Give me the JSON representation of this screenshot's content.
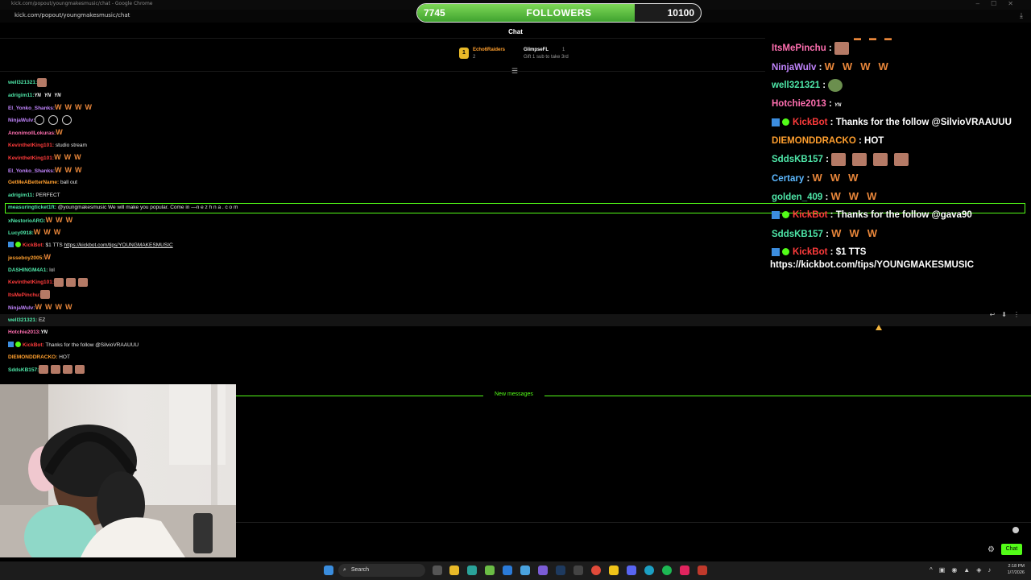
{
  "browser": {
    "title": "kick.com/popout/youngmakesmusic/chat - Google Chrome",
    "url": "kick.com/popout/youngmakesmusic/chat"
  },
  "followers_goal": {
    "current": "7745",
    "label": "FOLLOWERS",
    "goal": "10100",
    "progress": 0.767
  },
  "chat_title": "Chat",
  "pinned": {
    "user1": "Echo6Raiders",
    "user1_count": "2",
    "user1_rank": "1",
    "user2": "GlimpseFL",
    "user2_count": "1",
    "gift_text": "Gift 1 sub to take 3rd"
  },
  "small_chat": [
    {
      "user": "well321321:",
      "color": "#4ee6a8",
      "msg": ""
    },
    {
      "user": "adrigim11:",
      "color": "#4ee6a8",
      "msg": ""
    },
    {
      "user": "El_Yonko_Shanks:",
      "color": "#c084fc",
      "msg": ""
    },
    {
      "user": "NinjaWulv:",
      "color": "#c084fc",
      "msg": ""
    },
    {
      "user": "AnonimollLokuras:",
      "color": "#ff6fb0",
      "msg": ""
    },
    {
      "user": "KevinthetKing101:",
      "color": "#ff3b3b",
      "msg": "studio stream"
    },
    {
      "user": "KevinthetKing101:",
      "color": "#ff3b3b",
      "msg": ""
    },
    {
      "user": "El_Yonko_Shanks:",
      "color": "#c084fc",
      "msg": ""
    },
    {
      "user": "GetMeABetterName:",
      "color": "#ff9f2e",
      "msg": "ball out"
    },
    {
      "user": "adrigim11:",
      "color": "#4ee6a8",
      "msg": "PERFECT"
    },
    {
      "user": "measuringticket1ft:",
      "color": "#4ee6a8",
      "msg": "@youngmakesmusic We will make you popular. Come in —n e z h n a . c o m"
    },
    {
      "user": "xNestorioARG:",
      "color": "#4ee6a8",
      "msg": ""
    },
    {
      "user": "Lucy0918:",
      "color": "#4ee6a8",
      "msg": ""
    },
    {
      "user": "KickBot:",
      "color": "#ff3b3b",
      "msg": "$1 TTS",
      "link": "https://kickbot.com/tips/YOUNGMAKESMUSIC"
    },
    {
      "user": "jesseboy2005:",
      "color": "#ff9f2e",
      "msg": ""
    },
    {
      "user": "DASHINGM4A1:",
      "color": "#4ee6a8",
      "msg": "lol"
    },
    {
      "user": "KevinthetKing101:",
      "color": "#ff3b3b",
      "msg": ""
    },
    {
      "user": "ItsMePinchu:",
      "color": "#ff3b3b",
      "msg": ""
    },
    {
      "user": "NinjaWulv:",
      "color": "#c084fc",
      "msg": ""
    },
    {
      "user": "well321321:",
      "color": "#4ee6a8",
      "msg": "EZ"
    },
    {
      "user": "Hotchie2013:",
      "color": "#ff6fb0",
      "msg": ""
    },
    {
      "user": "KickBot:",
      "color": "#ff3b3b",
      "msg": "Thanks for the follow @SilvioVRAAUUU"
    },
    {
      "user": "DIEMONDDRACKO:",
      "color": "#ff9f2e",
      "msg": "HOT"
    },
    {
      "user": "SddsKB157:",
      "color": "#4ee6a8",
      "msg": ""
    }
  ],
  "big_chat": [
    {
      "user": "ItsMePinchu",
      "color": "#ff6fb0",
      "msg": ""
    },
    {
      "user": "NinjaWulv",
      "color": "#c084fc",
      "msg": ""
    },
    {
      "user": "well321321",
      "color": "#4ee6a8",
      "msg": ""
    },
    {
      "user": "Hotchie2013",
      "color": "#ff6fb0",
      "msg": ""
    },
    {
      "user": "KickBot",
      "color": "#ff3b3b",
      "msg": "Thanks for the follow @SilvioVRAAUUU"
    },
    {
      "user": "DIEMONDDRACKO",
      "color": "#ff9f2e",
      "msg": "HOT"
    },
    {
      "user": "SddsKB157",
      "color": "#4ee6a8",
      "msg": ""
    },
    {
      "user": "Certary",
      "color": "#5cb8ff",
      "msg": ""
    },
    {
      "user": "golden_409",
      "color": "#4ee6a8",
      "msg": ""
    },
    {
      "user": "KickBot",
      "color": "#ff3b3b",
      "msg": "Thanks for the follow @gava90"
    },
    {
      "user": "SddsKB157",
      "color": "#4ee6a8",
      "msg": ""
    },
    {
      "user": "KickBot",
      "color": "#ff3b3b",
      "msg": "$1 TTS"
    }
  ],
  "big_link": "https://kickbot.com/tips/YOUNGMAKESMUSIC",
  "emote_glyph": "W",
  "yn_glyph": "YN",
  "sep": ":",
  "new_messages": "New messages",
  "send_label": "Chat",
  "taskbar": {
    "search": "Search",
    "time": "2:18 PM",
    "date": "1/7/2026"
  },
  "colors": {
    "accent": "#53fc18"
  }
}
